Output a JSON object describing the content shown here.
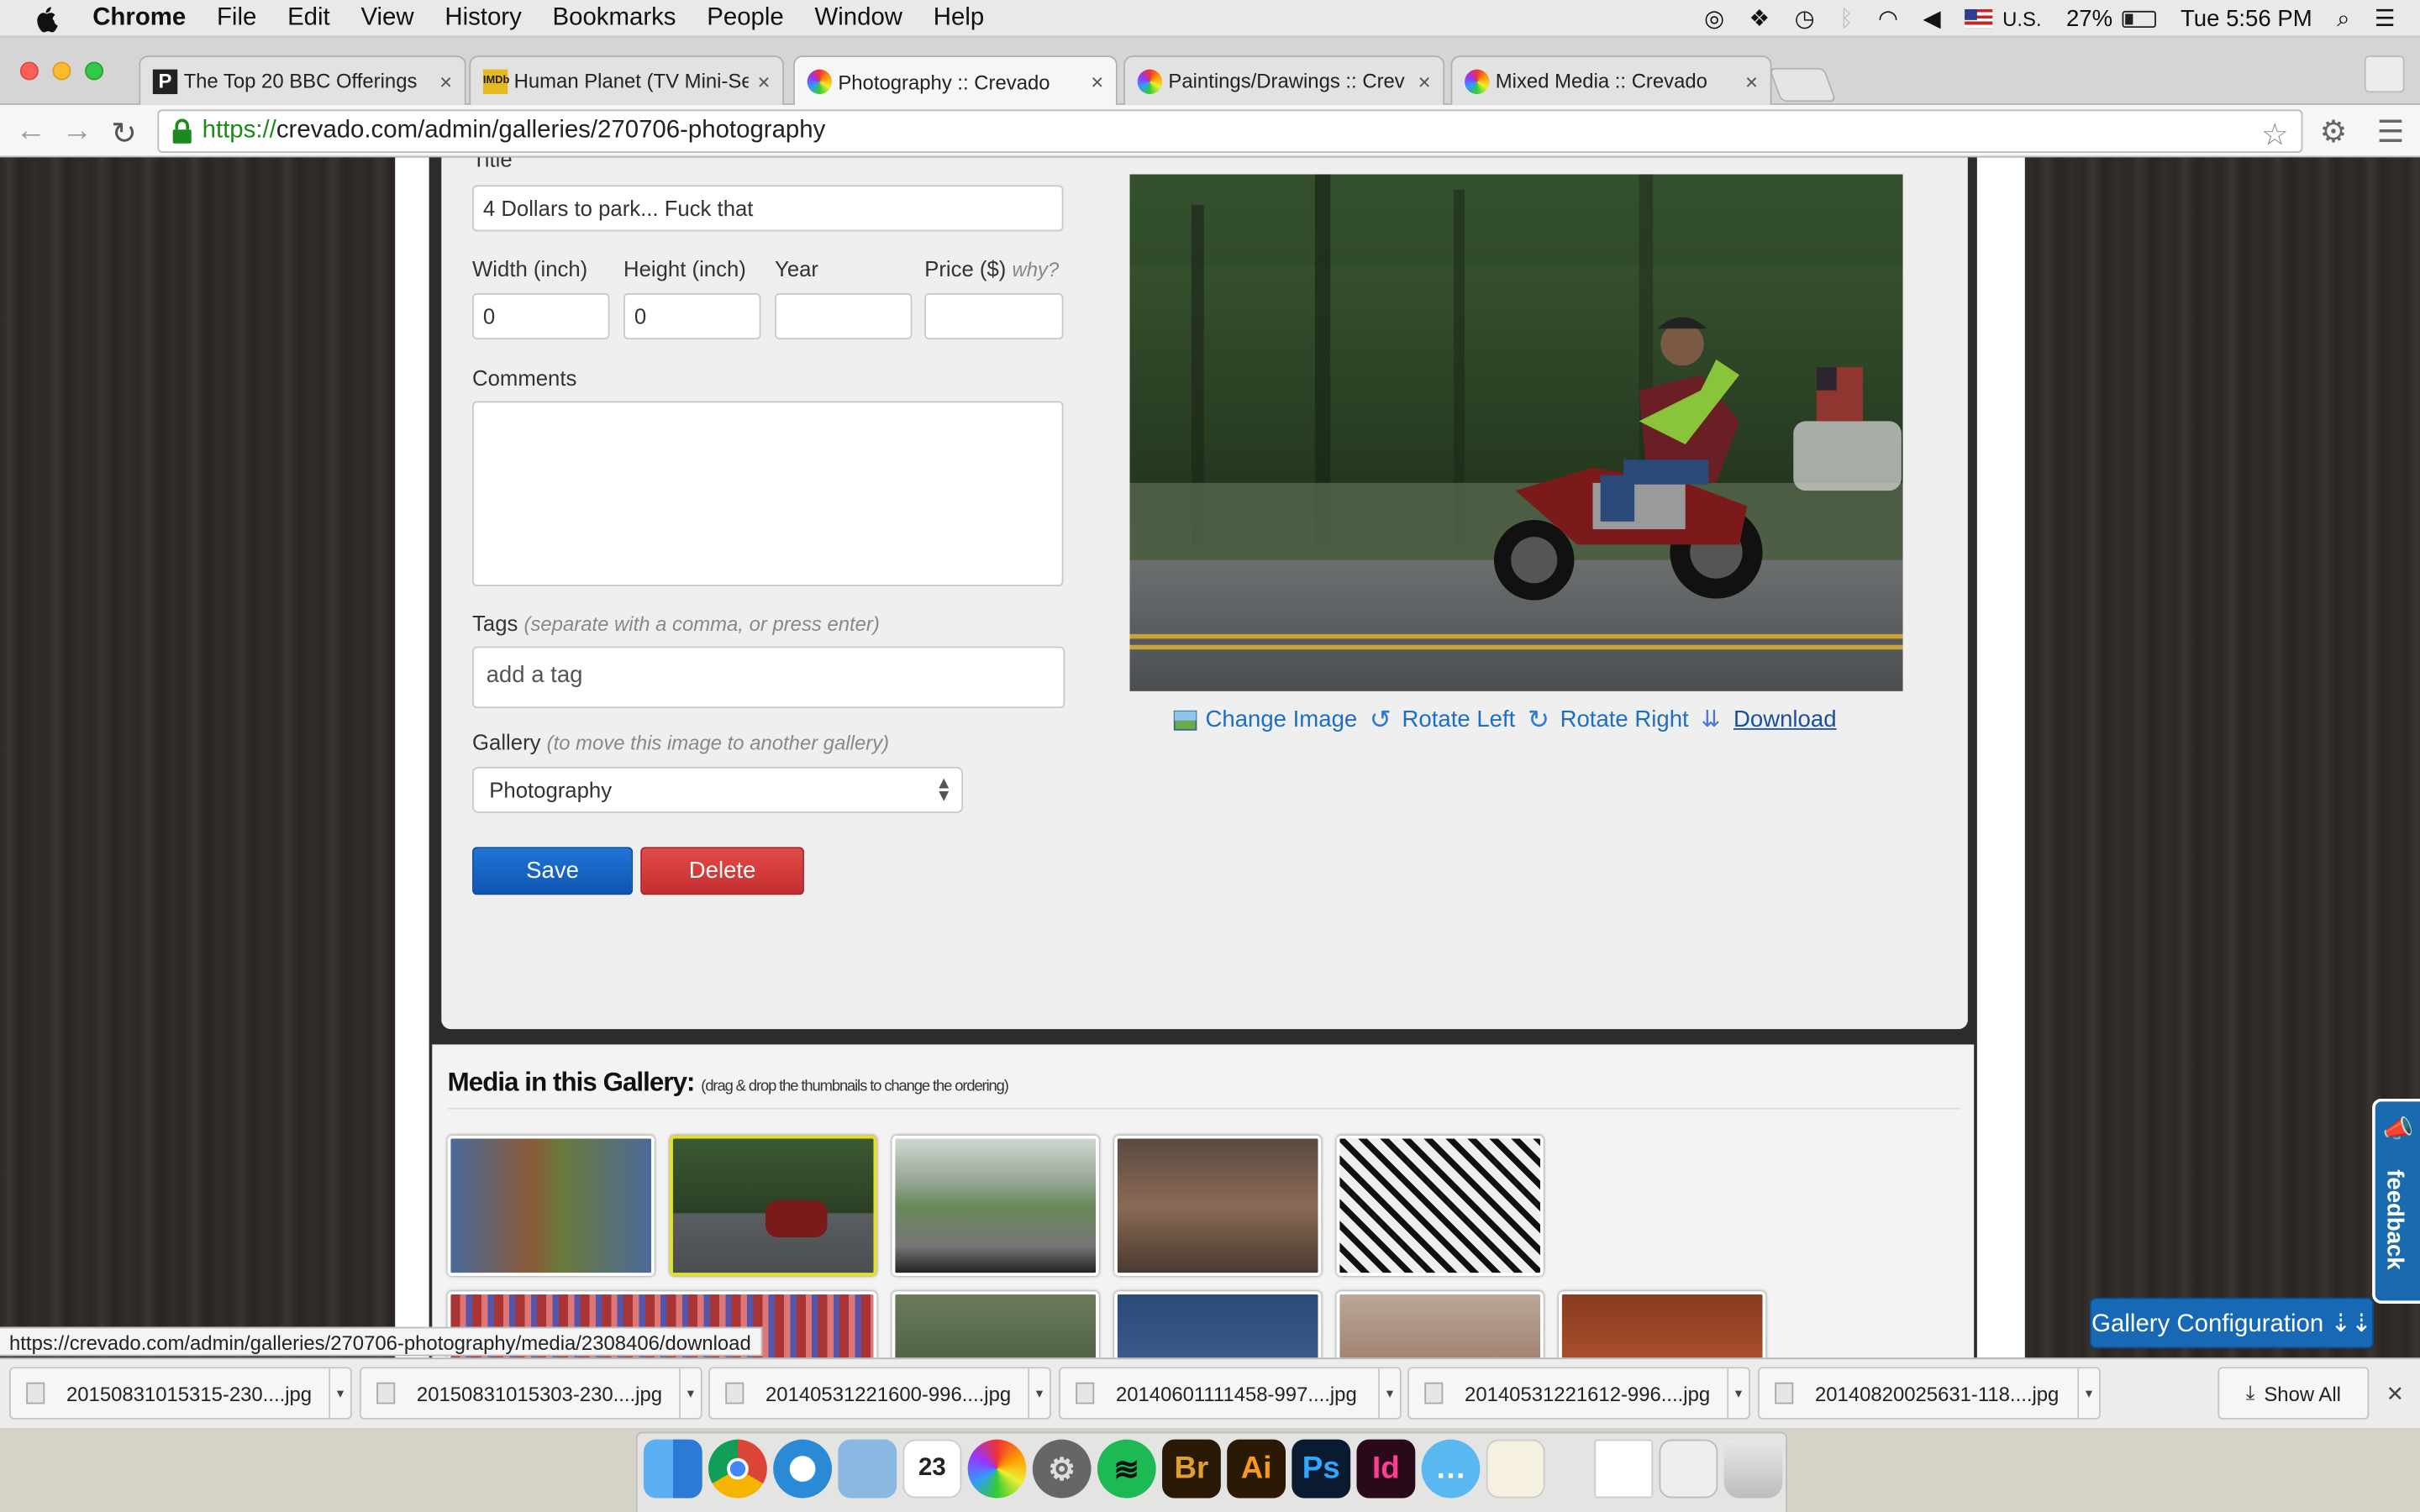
{
  "menubar": {
    "app": "Chrome",
    "items": [
      "File",
      "Edit",
      "View",
      "History",
      "Bookmarks",
      "People",
      "Window",
      "Help"
    ],
    "input_source": "U.S.",
    "battery": "27%",
    "clock": "Tue 5:56 PM"
  },
  "tabs": [
    {
      "title": "The Top 20 BBC Offerings",
      "icon": "p-icon"
    },
    {
      "title": "Human Planet (TV Mini-Se",
      "icon": "imdb-icon"
    },
    {
      "title": "Photography :: Crevado",
      "icon": "crevado-icon"
    },
    {
      "title": "Paintings/Drawings :: Crev",
      "icon": "crevado-icon"
    },
    {
      "title": "Mixed Media :: Crevado",
      "icon": "crevado-icon"
    }
  ],
  "address": {
    "scheme": "https://",
    "rest": "crevado.com/admin/galleries/270706-photography"
  },
  "form": {
    "title_label": "Title",
    "title_value": "4 Dollars to park... Fuck that",
    "width_label": "Width (inch)",
    "width_value": "0",
    "height_label": "Height (inch)",
    "height_value": "0",
    "year_label": "Year",
    "year_value": "",
    "price_label": "Price ($)",
    "price_hint": "why?",
    "price_value": "",
    "comments_label": "Comments",
    "tags_label": "Tags",
    "tags_hint": "(separate with a comma, or press enter)",
    "tags_placeholder": "add a tag",
    "gallery_label": "Gallery",
    "gallery_hint": "(to move this image to another gallery)",
    "gallery_value": "Photography",
    "save_label": "Save",
    "delete_label": "Delete"
  },
  "image_actions": {
    "change": "Change Image",
    "rotate_left": "Rotate Left",
    "rotate_right": "Rotate Right",
    "download": "Download"
  },
  "media": {
    "heading": "Media in this Gallery:",
    "hint": "(drag & drop the thumbnails to change the ordering)"
  },
  "status_url": "https://crevado.com/admin/galleries/270706-photography/media/2308406/download",
  "gallery_config": "Gallery Configuration ⇣⇣",
  "feedback": "feedback",
  "downloads": [
    "20150831015315-230....jpg",
    "20150831015303-230....jpg",
    "20140531221600-996....jpg",
    "20140601111458-997....jpg",
    "20140531221612-996....jpg",
    "20140820025631-118....jpg"
  ],
  "show_all": "Show All",
  "colors": {
    "link": "#1f6fbf",
    "save": "#1565c8",
    "delete": "#d63b3b",
    "selected_thumb": "#e5e21a",
    "config_button": "#1769b5"
  }
}
